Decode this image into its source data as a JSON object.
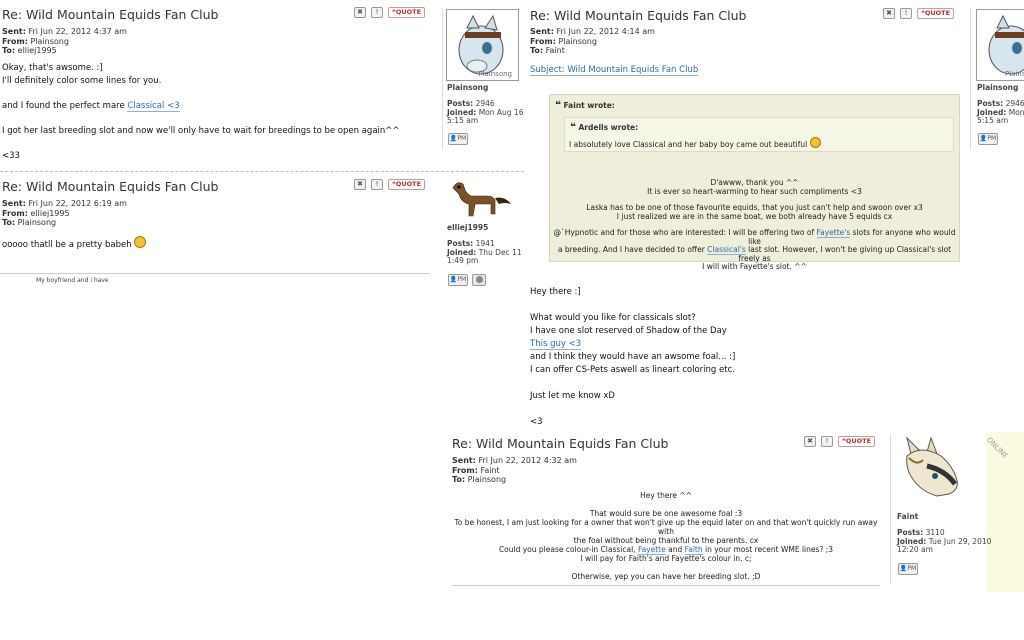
{
  "post_title": "Re: Wild Mountain Equids Fan Club",
  "labels": {
    "sent": "Sent:",
    "from": "From:",
    "to": "To:",
    "posts": "Posts:",
    "joined": "Joined:",
    "quote": "QUOTE",
    "pm": "PM",
    "subject": "Subject:",
    "online": "ONLINE"
  },
  "post1": {
    "sent": "Fri Jun 22, 2012 4:37 am",
    "from": "Plainsong",
    "to": "elliej1995",
    "line1": "Okay, that's awsome. :]",
    "line2": "I'll definitely color some lines for you.",
    "line3": "and I found the perfect mare ",
    "line3_link": "Classical <3",
    "line4": "I got her last breeding slot and now we'll only have to wait for breedings to be open again^^",
    "line5": "<33",
    "author": {
      "name": "Plainsong",
      "posts": "2946",
      "joined": "Mon Aug 16",
      "joined2": "5:15 am",
      "avatar_label": "Plainsong"
    }
  },
  "post2": {
    "sent": "Fri Jun 22, 2012 6:19 am",
    "from": "elliej1995",
    "to": "Plainsong",
    "line1": "ooooo thatll be a pretty babeh",
    "signature": "My boyfriend and i have",
    "author": {
      "name": "elliej1995",
      "posts": "1941",
      "joined": "Thu Dec 11",
      "joined2": "1:49 pm"
    }
  },
  "post3": {
    "sent": "Fri Jun 22, 2012 4:14 am",
    "from": "Plainsong",
    "to": "Faint",
    "subject": "Wild Mountain Equids Fan Club",
    "quote_outer_author": "Faint wrote:",
    "quote_inner_author": "Ardells wrote:",
    "quote_inner_text": "I absolutely love Classical and her baby boy came out beautiful",
    "q1": "D'awww, thank you ^^",
    "q2": "It is ever so heart-warming to hear such compliments <3",
    "q3": "Laska has to be one of those favourite equids, that you just can't help and swoon over x3",
    "q4": "I just realized we are in the same boat, we both already have 5 equids cx",
    "q5a": "@`Hypnotic and for those who are interested: I will be offering two of ",
    "q5b": "Fayette's",
    "q5c": " slots for anyone who would like",
    "q6a": "a breeding. And I have decided to offer ",
    "q6b": "Classical's",
    "q6c": " last slot. However, I won't be giving up Classical's slot freely as",
    "q7": "I will with Fayette's slot. ^^",
    "b1": "Hey there :]",
    "b2": "What would you like for classicals slot?",
    "b3": "I have one slot reserved of Shadow of the Day",
    "b4": "This guy <3",
    "b5": "and I think they would have an awsome foal... :]",
    "b6": "I can offer CS-Pets aswell as lineart coloring etc.",
    "b7": "Just let me know xD",
    "b8": "<3",
    "author": {
      "name": "Plainsong",
      "posts": "2946",
      "joined": "Mon",
      "joined2": "5:15 am",
      "avatar_label": "Plains"
    }
  },
  "post4": {
    "sent": "Fri Jun 22, 2012 4:32 am",
    "from": "Faint",
    "to": "Plainsong",
    "c1": "Hey there ^^",
    "c2": "That would sure be one awesome foal :3",
    "c3": "To be honest, I am just looking for a owner that won't give up the equid later on and that won't quickly run away with",
    "c4": "the foal without being thankful to the parents. cx",
    "c5a": "Could you please colour-in Classical, ",
    "c5b": "Fayette",
    "c5c": " and ",
    "c5d": "Faith",
    "c5e": " in your most recent WME lines? ;3",
    "c6": "I will pay for Faith's and Fayette's colour in. c;",
    "c7": "Otherwise, yep you can have her breeding slot. ;D",
    "author": {
      "name": "Faint",
      "posts": "3110",
      "joined": "Tue Jun 29, 2010",
      "joined2": "12:20 am"
    }
  },
  "colors": {
    "link": "#2b6aa8",
    "quote_bg": "#eeeeda",
    "quote_btn": "#a33333"
  },
  "icons": [
    "report-icon",
    "warn-icon",
    "quote-icon",
    "pm-icon",
    "smiley-icon",
    "online-badge"
  ]
}
